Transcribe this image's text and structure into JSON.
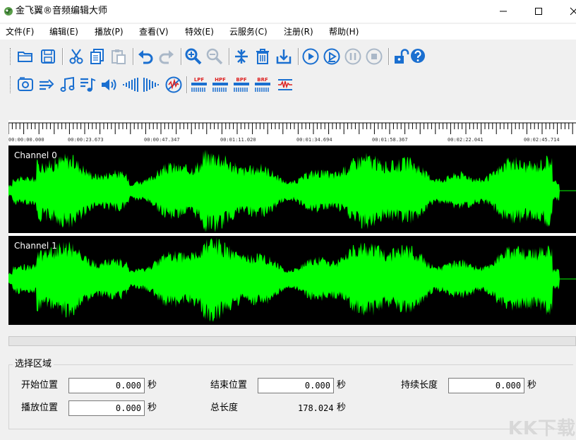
{
  "window": {
    "title": "金飞翼®音频编辑大师",
    "controls": [
      "minimize-icon",
      "maximize-icon",
      "close-icon"
    ]
  },
  "menu": [
    {
      "label": "文件(F)"
    },
    {
      "label": "编辑(E)"
    },
    {
      "label": "播放(P)"
    },
    {
      "label": "查看(V)"
    },
    {
      "label": "特效(E)"
    },
    {
      "label": "云服务(C)"
    },
    {
      "label": "注册(R)"
    },
    {
      "label": "帮助(H)"
    }
  ],
  "toolbar1": [
    "open-folder-icon",
    "save-icon",
    "|",
    "cut-icon",
    "copy-icon",
    "paste-icon",
    "|",
    "undo-icon",
    "redo-icon",
    "|",
    "zoom-in-icon",
    "zoom-out-icon",
    "|",
    "select-all-icon",
    "delete-icon",
    "trim-icon",
    "|",
    "play-icon",
    "play-selection-icon",
    "pause-icon",
    "stop-icon",
    "|",
    "unlock-icon",
    "help-icon"
  ],
  "toolbar2": [
    "record-icon",
    "noise-reduction-icon",
    "music-note-icon",
    "music-notes-icon",
    "volume-icon",
    "fade-in-icon",
    "fade-out-icon",
    "mute-icon",
    "|",
    "lowpass-filter-icon",
    "highpass-filter-icon",
    "bandpass-filter-icon",
    "bandreject-filter-icon",
    "equalizer-icon"
  ],
  "filter_labels": [
    "LPF",
    "HPF",
    "BPF",
    "BRF"
  ],
  "ruler": {
    "labels": [
      "00:00:00.000",
      "00:00:23.673",
      "00:00:47.347",
      "00:01:11.020",
      "00:01:34.694",
      "00:01:58.367",
      "00:02:22.041",
      "00:02:45.714"
    ]
  },
  "channels": [
    {
      "label": "Channel 0"
    },
    {
      "label": "Channel 1"
    }
  ],
  "colors": {
    "waveform": "#00ff00",
    "wave_bg": "#000000",
    "icon_blue": "#1a6fd0"
  },
  "selection": {
    "group_title": "选择区域",
    "start_label": "开始位置",
    "start_value": "0.000",
    "end_label": "结束位置",
    "end_value": "0.000",
    "duration_label": "持续长度",
    "duration_value": "0.000",
    "play_label": "播放位置",
    "play_value": "0.000",
    "total_label": "总长度",
    "total_value": "178.024",
    "unit": "秒"
  },
  "watermark": "KK下载"
}
